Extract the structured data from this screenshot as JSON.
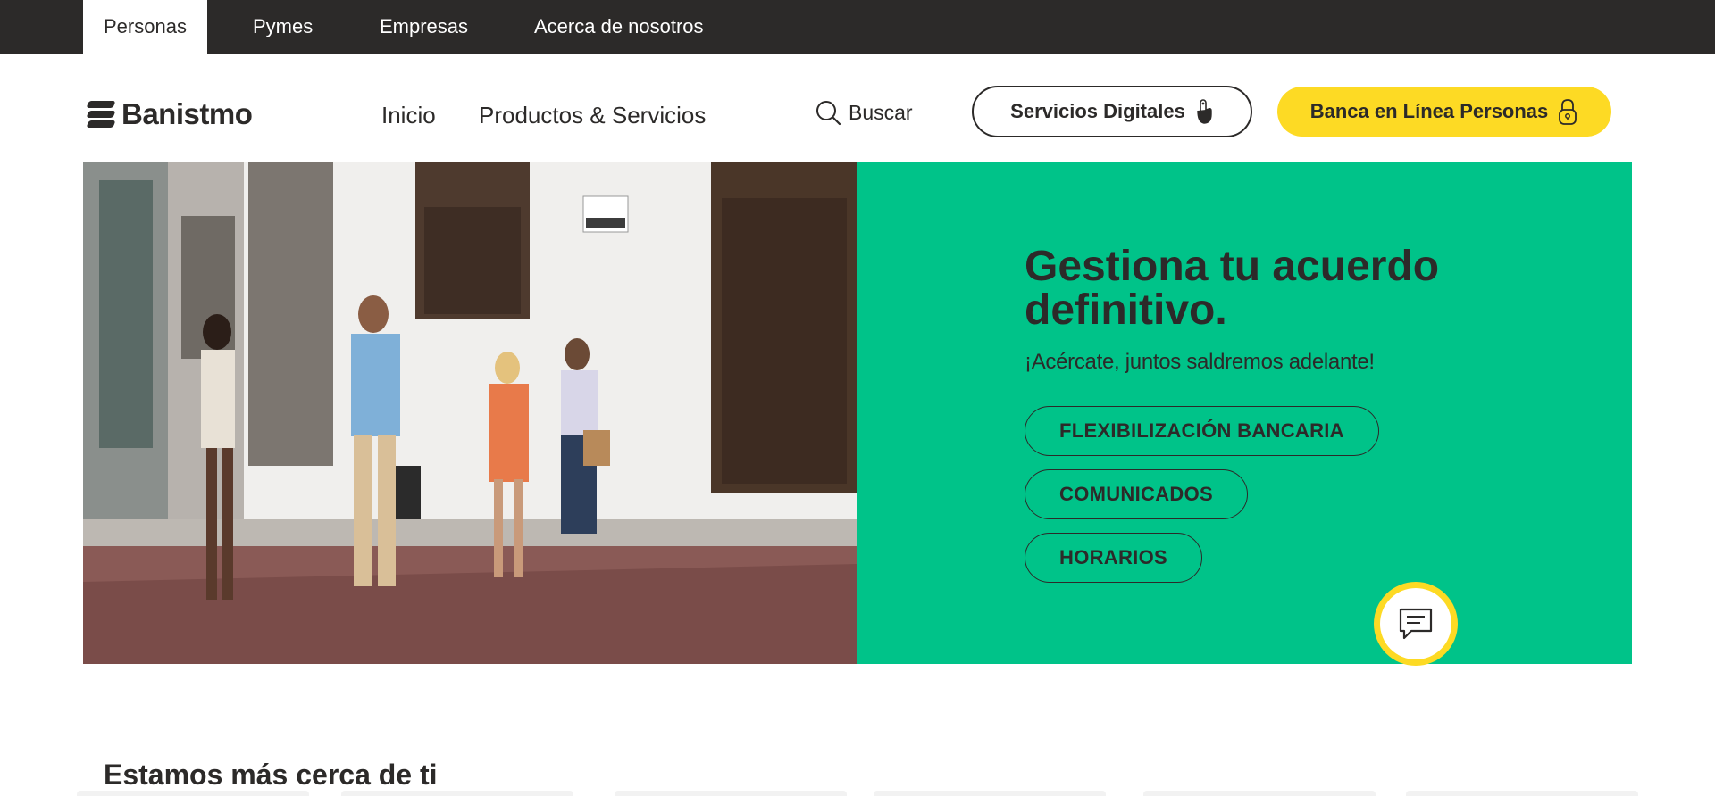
{
  "segments": {
    "items": [
      {
        "label": "Personas",
        "active": true
      },
      {
        "label": "Pymes",
        "active": false
      },
      {
        "label": "Empresas",
        "active": false
      },
      {
        "label": "Acerca de nosotros",
        "active": false
      }
    ]
  },
  "header": {
    "logo_text": "Banistmo",
    "nav": [
      {
        "label": "Inicio"
      },
      {
        "label": "Productos & Servicios"
      }
    ],
    "search_label": "Buscar",
    "digital_button_label": "Servicios Digitales",
    "online_banking_label": "Banca en Línea Personas"
  },
  "hero": {
    "title": "Gestiona tu acuerdo definitivo.",
    "subtitle": "¡Acércate, juntos saldremos adelante!",
    "buttons": [
      {
        "label": "FLEXIBILIZACIÓN BANCARIA"
      },
      {
        "label": "COMUNICADOS"
      },
      {
        "label": "HORARIOS"
      }
    ]
  },
  "section": {
    "title": "Estamos más cerca de ti"
  },
  "colors": {
    "dark": "#2c2a29",
    "brand_green": "#00c389",
    "brand_yellow": "#fdda24",
    "white": "#ffffff"
  },
  "icons": {
    "search": "search-icon",
    "digital": "hand-pointer-icon",
    "banking": "lock-icon",
    "chat": "chat-icon"
  }
}
